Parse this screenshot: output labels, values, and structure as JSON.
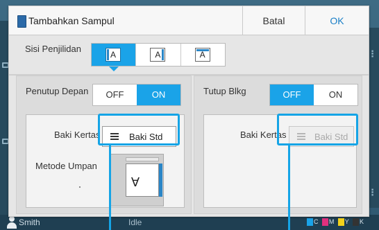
{
  "dialog": {
    "title": "Tambahkan Sampul",
    "cancel_label": "Batal",
    "ok_label": "OK"
  },
  "binding": {
    "label": "Sisi Penjilidan",
    "options": [
      {
        "icon": "A",
        "edge": "left"
      },
      {
        "icon": "A",
        "edge": "right"
      },
      {
        "icon": "A",
        "edge": "top"
      }
    ],
    "selected_index": 0
  },
  "front_cover": {
    "label": "Penutup Depan",
    "off_label": "OFF",
    "on_label": "ON",
    "state": "ON",
    "tray_label": "Baki Kertas",
    "tray_value": "Baki Std",
    "feed_label": "Metode Umpan",
    "feed_icon": "A"
  },
  "back_cover": {
    "label": "Tutup Blkg",
    "off_label": "OFF",
    "on_label": "ON",
    "state": "OFF",
    "tray_label": "Baki Kertas",
    "tray_value": "Baki Std"
  },
  "statusbar": {
    "user": "Smith",
    "status": "Idle",
    "ink_labels": [
      "C",
      "M",
      "Y",
      "K"
    ]
  },
  "colors": {
    "accent": "#1aa3e8",
    "callout": "#15a4e6",
    "ink_cyan": "#1aa3e8",
    "ink_magenta": "#e0307e",
    "ink_yellow": "#f2d21b",
    "ink_black": "#333333"
  }
}
